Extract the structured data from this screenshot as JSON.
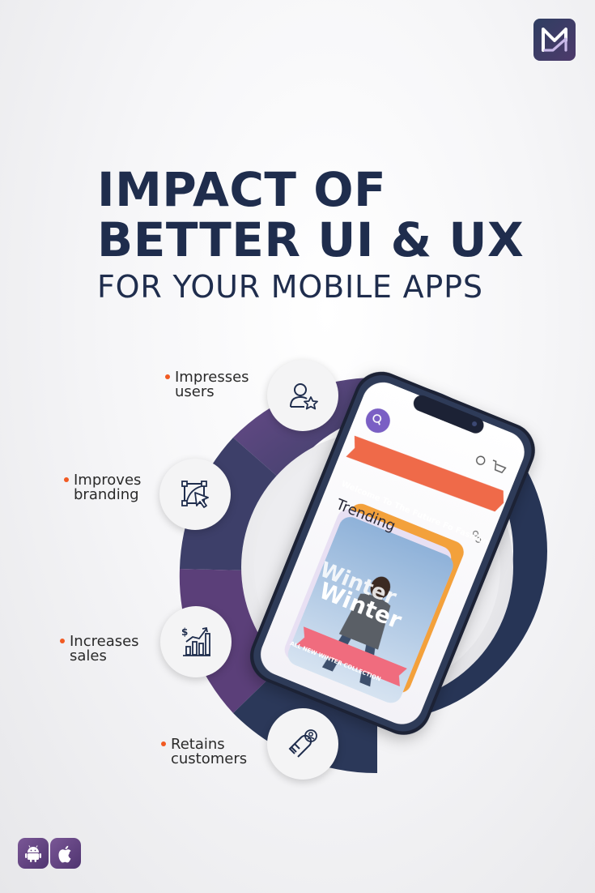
{
  "colors": {
    "navy": "#1f2d4d",
    "purple": "#5b3f79",
    "accent_orange": "#f15a22",
    "phone_accent": "#7a5fc4",
    "ribbon": "#ef6b4a"
  },
  "brand": {
    "logo_icon": "monogram-icon"
  },
  "headline": {
    "line1": "IMPACT OF",
    "line2": "BETTER UI & UX",
    "line3": "FOR YOUR MOBILE APPS"
  },
  "benefits": [
    {
      "line1": "Impresses",
      "line2": "users",
      "icon": "user-star-icon"
    },
    {
      "line1": "Improves",
      "line2": "branding",
      "icon": "brand-design-icon"
    },
    {
      "line1": "Increases",
      "line2": "sales",
      "icon": "sales-growth-icon"
    },
    {
      "line1": "Retains",
      "line2": "customers",
      "icon": "customer-magnet-icon"
    }
  ],
  "phone_screen": {
    "banner": "Welcome To The Future Fo Fashion",
    "section_title": "Trending",
    "card_title_1": "Winter",
    "card_title_2": "Winter",
    "card_ribbon": "ALL NEW WINTER COLLECTION"
  },
  "platforms": [
    {
      "name": "android-icon"
    },
    {
      "name": "apple-icon"
    }
  ]
}
